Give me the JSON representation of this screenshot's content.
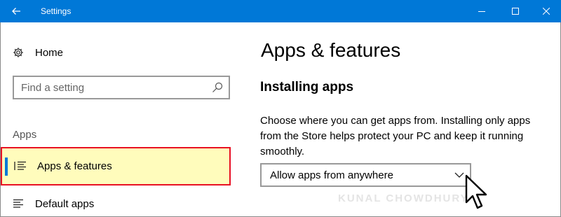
{
  "window": {
    "title": "Settings"
  },
  "sidebar": {
    "home_label": "Home",
    "search_placeholder": "Find a setting",
    "group_label": "Apps",
    "items": [
      {
        "label": "Apps & features",
        "icon": "list-icon",
        "selected": true
      },
      {
        "label": "Default apps",
        "icon": "list-icon",
        "selected": false
      }
    ]
  },
  "main": {
    "page_title": "Apps & features",
    "section_title": "Installing apps",
    "description": "Choose where you can get apps from. Installing only apps from the Store helps protect your PC and keep it running smoothly.",
    "dropdown_value": "Allow apps from anywhere"
  },
  "watermark": "KUNAL CHOWDHURY",
  "colors": {
    "titlebar": "#0078d7",
    "highlight": "#fffcbc",
    "highlight_border": "#e81123",
    "accent": "#0078d7"
  }
}
